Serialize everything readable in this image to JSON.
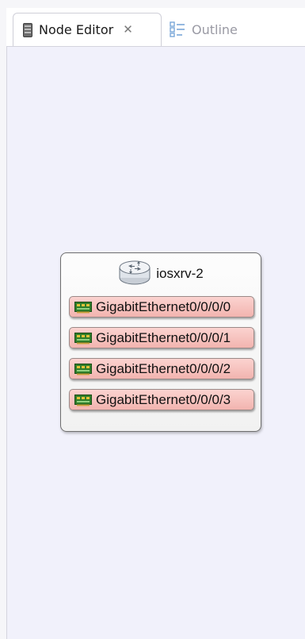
{
  "tabs": [
    {
      "label": "Node Editor",
      "icon": "server-icon",
      "active": true,
      "closable": true
    },
    {
      "label": "Outline",
      "icon": "outline-icon",
      "active": false,
      "closable": false
    }
  ],
  "node": {
    "name": "iosxrv-2",
    "icon": "router-icon",
    "interfaces": [
      {
        "label": "GigabitEthernet0/0/0/0",
        "icon": "network-card-icon"
      },
      {
        "label": "GigabitEthernet0/0/0/1",
        "icon": "network-card-icon"
      },
      {
        "label": "GigabitEthernet0/0/0/2",
        "icon": "network-card-icon"
      },
      {
        "label": "GigabitEthernet0/0/0/3",
        "icon": "network-card-icon"
      }
    ]
  },
  "colors": {
    "editor_background": "#f1f1fb",
    "interface_fill": "#f6c2be",
    "tab_inactive_text": "#9a9aa4"
  }
}
